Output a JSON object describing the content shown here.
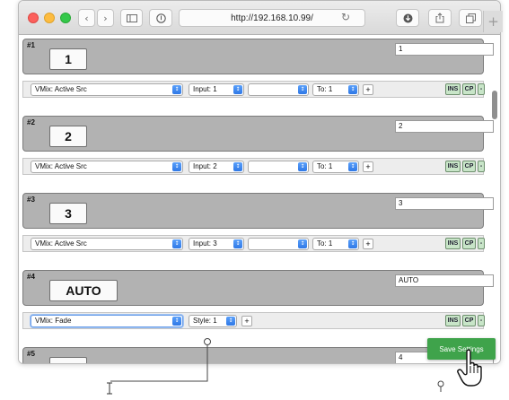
{
  "browser": {
    "url": "http://192.168.10.99/",
    "back_icon": "chevron-left",
    "forward_icon": "chevron-right",
    "sidebar_icon": "sidebar",
    "privacy_icon": "info-circle",
    "reload_icon": "reload",
    "download_icon": "download",
    "share_icon": "share",
    "tabs_icon": "tabs",
    "new_tab_label": "+"
  },
  "blocks": [
    {
      "num": "#1",
      "key": "1",
      "label": "1",
      "action": "VMix: Active Src",
      "param_label": "Input: 1",
      "param2": "",
      "to": "To: 1"
    },
    {
      "num": "#2",
      "key": "2",
      "label": "2",
      "action": "VMix: Active Src",
      "param_label": "Input: 2",
      "param2": "",
      "to": "To: 1"
    },
    {
      "num": "#3",
      "key": "3",
      "label": "3",
      "action": "VMix: Active Src",
      "param_label": "Input: 3",
      "param2": "",
      "to": "To: 1"
    },
    {
      "num": "#4",
      "key": "AUTO",
      "label": "AUTO",
      "action": "VMix: Fade",
      "param_label": "Style: 1"
    },
    {
      "num": "#5",
      "key": "",
      "label": "4"
    }
  ],
  "buttons": {
    "ins": "INS",
    "cp": "CP",
    "minus": "-",
    "plus": "+",
    "save": "Save Settings"
  },
  "colors": {
    "save_green": "#3fa34b",
    "select_chevron": "#2f78e6",
    "small_button_green": "#c8e5c8",
    "block_gray": "#b2b2b2"
  }
}
